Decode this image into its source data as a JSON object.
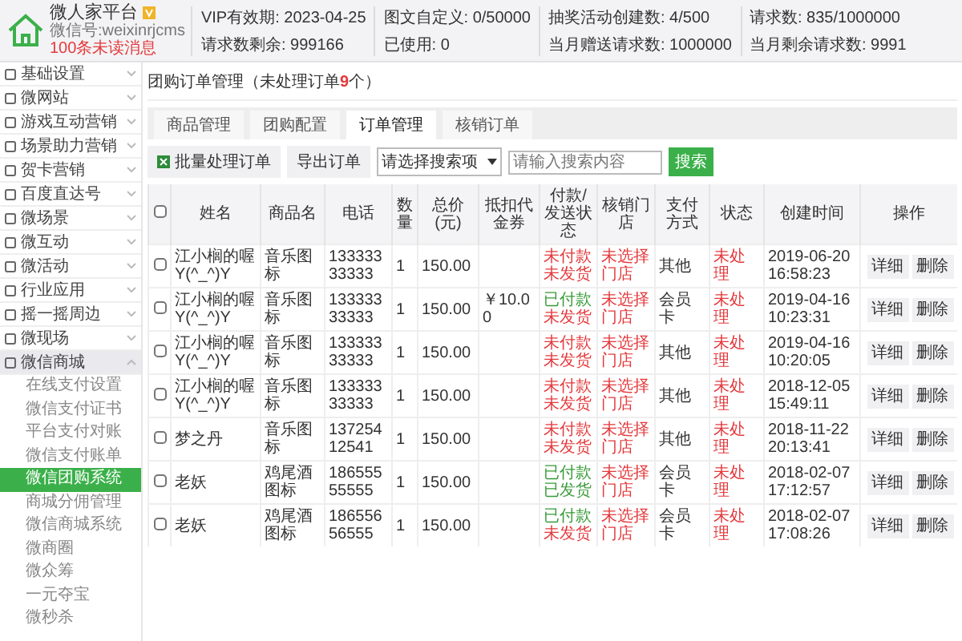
{
  "header": {
    "platform_name": "微人家平台",
    "account": "微信号:weixinrjcms",
    "unread": "100条未读消息",
    "stats": [
      [
        "VIP有效期: 2023-04-25",
        "请求数剩余: 999166"
      ],
      [
        "图文自定义: 0/50000",
        "已使用: 0"
      ],
      [
        "抽奖活动创建数: 4/500",
        "当月赠送请求数: 1000000"
      ],
      [
        "请求数: 835/1000000",
        "当月剩余请求数: 9991"
      ]
    ]
  },
  "sidebar": {
    "items": [
      {
        "label": "基础设置",
        "expanded": false,
        "selected": false
      },
      {
        "label": "微网站",
        "expanded": false,
        "selected": false
      },
      {
        "label": "游戏互动营销",
        "expanded": false,
        "selected": false
      },
      {
        "label": "场景助力营销",
        "expanded": false,
        "selected": false
      },
      {
        "label": "贺卡营销",
        "expanded": false,
        "selected": false
      },
      {
        "label": "百度直达号",
        "expanded": false,
        "selected": false
      },
      {
        "label": "微场景",
        "expanded": false,
        "selected": false
      },
      {
        "label": "微互动",
        "expanded": false,
        "selected": false
      },
      {
        "label": "微活动",
        "expanded": false,
        "selected": false
      },
      {
        "label": "行业应用",
        "expanded": false,
        "selected": false
      },
      {
        "label": "摇一摇周边",
        "expanded": false,
        "selected": false
      },
      {
        "label": "微现场",
        "expanded": false,
        "selected": false
      },
      {
        "label": "微信商城",
        "expanded": true,
        "selected": false,
        "children": [
          {
            "label": "在线支付设置",
            "selected": false
          },
          {
            "label": "微信支付证书",
            "selected": false
          },
          {
            "label": "平台支付对账",
            "selected": false
          },
          {
            "label": "微信支付账单",
            "selected": false
          },
          {
            "label": "微信团购系统",
            "selected": true
          },
          {
            "label": "商城分佣管理",
            "selected": false
          },
          {
            "label": "微信商城系统",
            "selected": false
          },
          {
            "label": "微商圈",
            "selected": false
          },
          {
            "label": "微众筹",
            "selected": false
          },
          {
            "label": "一元夺宝",
            "selected": false
          },
          {
            "label": "微秒杀",
            "selected": false
          }
        ]
      }
    ]
  },
  "page": {
    "title": "团购订单管理（未处理订单",
    "unprocessed_count": "9",
    "title_end": "个）",
    "tabs": [
      {
        "label": "商品管理",
        "selected": false
      },
      {
        "label": "团购配置",
        "selected": false
      },
      {
        "label": "订单管理",
        "selected": true
      },
      {
        "label": "核销订单",
        "selected": false
      }
    ],
    "toolbar": {
      "batch_button": "批量处理订单",
      "export_button": "导出订单",
      "search_select": "请选择搜索项",
      "search_placeholder": "请输入搜索内容",
      "search_button": "搜索"
    },
    "table": {
      "select_all_checked": false,
      "columns": [
        "姓名",
        "商品名",
        "电话",
        "数量",
        "总价(元)",
        "抵扣代金券",
        "付款/发送状态",
        "核销门店",
        "支付方式",
        "状态",
        "创建时间",
        "操作"
      ],
      "rows": [
        {
          "checked": false,
          "name": "江小榈的喔Y(^_^)Y",
          "product": "音乐图标",
          "phone": "13333333333",
          "quantity": "1",
          "total": "150.00",
          "voucher": "",
          "payment": {
            "text": "未付款",
            "done": false
          },
          "shipping": {
            "text": "未发货",
            "done": false
          },
          "store": "未选择门店",
          "method": "其他",
          "status": "未处理",
          "created": "2019-06-20 16:58:23",
          "actions": [
            "详细",
            "删除"
          ]
        },
        {
          "checked": false,
          "name": "江小榈的喔Y(^_^)Y",
          "product": "音乐图标",
          "phone": "13333333333",
          "quantity": "1",
          "total": "150.00",
          "voucher": "￥10.00",
          "payment": {
            "text": "已付款",
            "done": true
          },
          "shipping": {
            "text": "未发货",
            "done": false
          },
          "store": "未选择门店",
          "method": "会员卡",
          "status": "未处理",
          "created": "2019-04-16 10:23:31",
          "actions": [
            "详细",
            "删除"
          ]
        },
        {
          "checked": false,
          "name": "江小榈的喔Y(^_^)Y",
          "product": "音乐图标",
          "phone": "13333333333",
          "quantity": "1",
          "total": "150.00",
          "voucher": "",
          "payment": {
            "text": "未付款",
            "done": false
          },
          "shipping": {
            "text": "未发货",
            "done": false
          },
          "store": "未选择门店",
          "method": "其他",
          "status": "未处理",
          "created": "2019-04-16 10:20:05",
          "actions": [
            "详细",
            "删除"
          ]
        },
        {
          "checked": false,
          "name": "江小榈的喔Y(^_^)Y",
          "product": "音乐图标",
          "phone": "13333333333",
          "quantity": "1",
          "total": "150.00",
          "voucher": "",
          "payment": {
            "text": "未付款",
            "done": false
          },
          "shipping": {
            "text": "未发货",
            "done": false
          },
          "store": "未选择门店",
          "method": "其他",
          "status": "未处理",
          "created": "2018-12-05 15:49:11",
          "actions": [
            "详细",
            "删除"
          ]
        },
        {
          "checked": false,
          "name": "梦之丹",
          "product": "音乐图标",
          "phone": "13725412541",
          "quantity": "1",
          "total": "150.00",
          "voucher": "",
          "payment": {
            "text": "未付款",
            "done": false
          },
          "shipping": {
            "text": "未发货",
            "done": false
          },
          "store": "未选择门店",
          "method": "其他",
          "status": "未处理",
          "created": "2018-11-22 20:13:41",
          "actions": [
            "详细",
            "删除"
          ]
        },
        {
          "checked": false,
          "name": "老妖",
          "product": "鸡尾酒图标",
          "phone": "18655555555",
          "quantity": "1",
          "total": "150.00",
          "voucher": "",
          "payment": {
            "text": "已付款",
            "done": true
          },
          "shipping": {
            "text": "已发货",
            "done": true
          },
          "store": "未选择门店",
          "method": "会员卡",
          "status": "未处理",
          "created": "2018-02-07 17:12:57",
          "actions": [
            "详细",
            "删除"
          ]
        },
        {
          "checked": false,
          "name": "老妖",
          "product": "鸡尾酒图标",
          "phone": "18655656555",
          "quantity": "1",
          "total": "150.00",
          "voucher": "",
          "payment": {
            "text": "已付款",
            "done": true
          },
          "shipping": {
            "text": "未发货",
            "done": false
          },
          "store": "未选择门店",
          "method": "会员卡",
          "status": "未处理",
          "created": "2018-02-07 17:08:26",
          "actions": [
            "详细",
            "删除"
          ]
        }
      ]
    }
  }
}
